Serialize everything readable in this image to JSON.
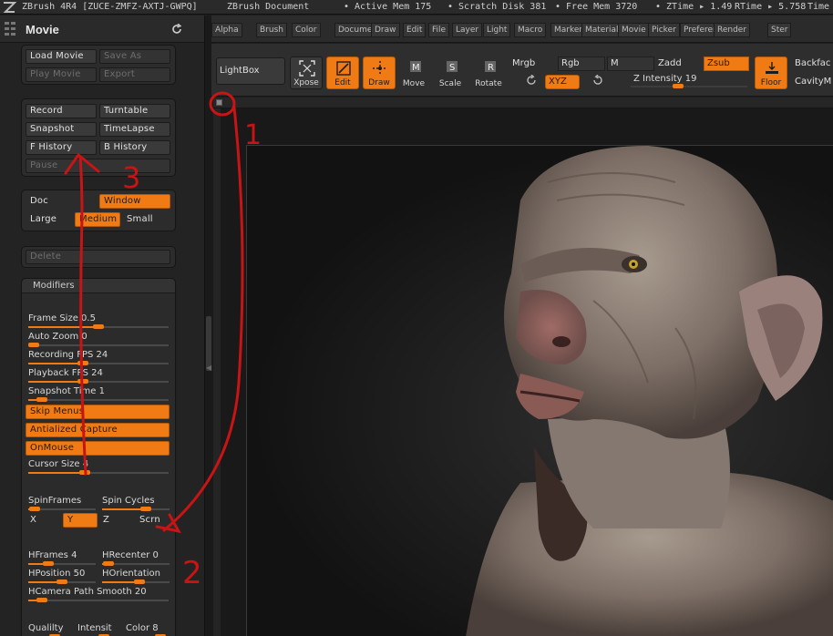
{
  "titlebar": {
    "app": "ZBrush 4R4 [ZUCE-ZMFZ-AXTJ-GWPQ]",
    "document": "ZBrush Document",
    "active_mem": "• Active Mem 175",
    "scratch_disk": "• Scratch Disk 381",
    "free_mem": "• Free Mem 3720",
    "ztime": "• ZTime ▸ 1.49",
    "rtime": "RTime ▸ 5.758",
    "timer": "Time"
  },
  "panel": {
    "title": "Movie",
    "load_movie": "Load Movie",
    "save_as": "Save As",
    "play_movie": "Play Movie",
    "export": "Export",
    "record": "Record",
    "turntable": "Turntable",
    "snapshot": "Snapshot",
    "timelapse": "TimeLapse",
    "f_history": "F History",
    "b_history": "B History",
    "pause": "Pause",
    "doc": "Doc",
    "window": "Window",
    "large": "Large",
    "medium": "Medium",
    "small": "Small",
    "delete": "Delete"
  },
  "modifiers": {
    "header": "Modifiers",
    "sliders": [
      {
        "label": "Frame Size 0.5",
        "value": 0.5,
        "min": 0,
        "max": 1
      },
      {
        "label": "Auto Zoom 0",
        "value": 0,
        "min": 0,
        "max": 1
      },
      {
        "label": "Recording FPS 24",
        "value": 24,
        "min": 1,
        "max": 60
      },
      {
        "label": "Playback FPS 24",
        "value": 24,
        "min": 1,
        "max": 60
      },
      {
        "label": "Snapshot Time 1",
        "value": 1,
        "min": 0,
        "max": 10
      }
    ],
    "skip_menus": "Skip Menus",
    "antialiased_capture": "Antialized Capture",
    "onmouse": "OnMouse",
    "cursor_size": {
      "label": "Cursor Size 4",
      "value": 4,
      "min": 0,
      "max": 10
    },
    "spinframes": {
      "label": "SpinFrames",
      "value": 0.1
    },
    "spin_cycles": {
      "label": "Spin Cycles",
      "value": 0.65
    },
    "axis": {
      "x": "X",
      "y": "Y",
      "z": "Z",
      "scrn": "Scrn"
    },
    "hframes": {
      "label": "HFrames 4",
      "value": 0.3
    },
    "hrecenter": {
      "label": "HRecenter 0",
      "value": 0.1
    },
    "hposition": {
      "label": "HPosition 50",
      "value": 0.5
    },
    "horientation": {
      "label": "HOrientation",
      "value": 0.55
    },
    "hcamera": {
      "label": "HCamera Path Smooth 20",
      "value": 0.1
    },
    "qualilty": {
      "label": "Qualilty",
      "value": 0.6
    },
    "intensit": {
      "label": "Intensit",
      "value": 0.6
    },
    "color8": {
      "label": "Color 8",
      "value": 0.8
    }
  },
  "menubar": {
    "items": [
      "Alpha",
      "Brush",
      "Color",
      "Document",
      "Draw",
      "Edit",
      "File",
      "Layer",
      "Light",
      "Macro",
      "Marker",
      "Material",
      "Movie",
      "Picker",
      "Preferences",
      "Render",
      "Ster"
    ]
  },
  "shelf": {
    "lightbox": "LightBox",
    "xpose": "Xpose",
    "edit": "Edit",
    "draw": "Draw",
    "move": "Move",
    "scale": "Scale",
    "rotate": "Rotate",
    "mrgb": "Mrgb",
    "rgb": "Rgb",
    "m": "M",
    "zadd": "Zadd",
    "zsub": "Zsub",
    "xyz": "XYZ",
    "z_intensity": "Z Intensity 19",
    "floor": "Floor",
    "backface": "Backfac",
    "cavity": "CavityM"
  },
  "annotations": {
    "one": "1",
    "two": "2",
    "three": "3"
  },
  "colors": {
    "accent": "#f07a14",
    "annotation": "#c81414",
    "panel_bg": "#232323"
  }
}
